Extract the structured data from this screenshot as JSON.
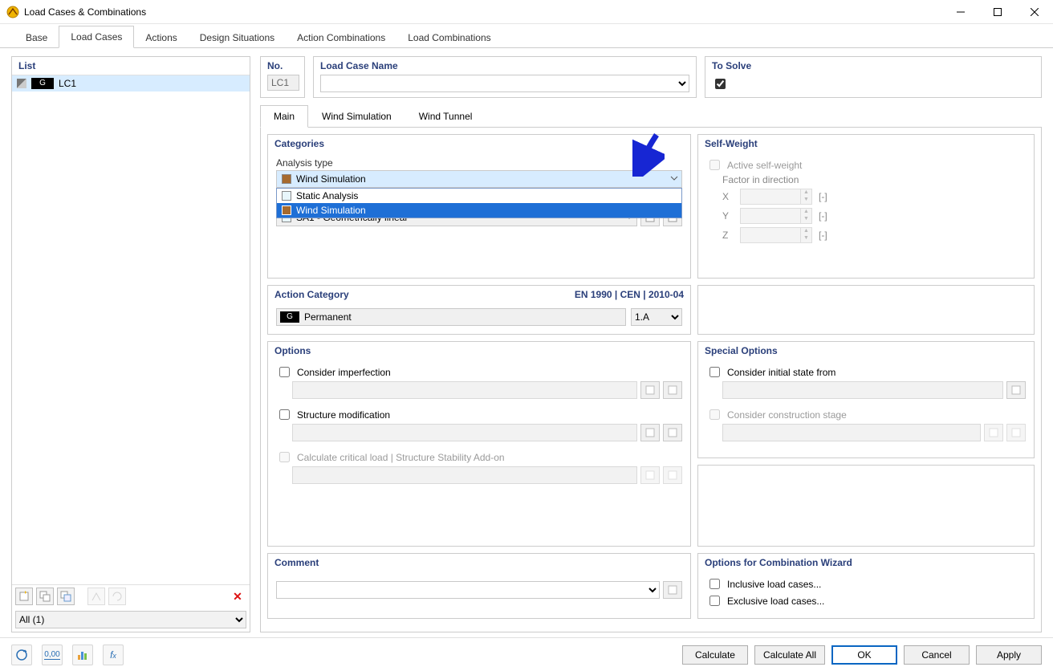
{
  "window": {
    "title": "Load Cases & Combinations"
  },
  "mainTabs": {
    "items": [
      "Base",
      "Load Cases",
      "Actions",
      "Design Situations",
      "Action Combinations",
      "Load Combinations"
    ],
    "active": 1
  },
  "list": {
    "header": "List",
    "rows": [
      {
        "badge": "G",
        "name": "LC1"
      }
    ],
    "filter": "All (1)"
  },
  "top": {
    "noLabel": "No.",
    "noValue": "LC1",
    "nameLabel": "Load Case Name",
    "nameValue": "",
    "solveLabel": "To Solve",
    "solveChecked": true
  },
  "innerTabs": {
    "items": [
      "Main",
      "Wind Simulation",
      "Wind Tunnel"
    ],
    "active": 0
  },
  "categories": {
    "header": "Categories",
    "analysisTypeLabel": "Analysis type",
    "analysisTypeValue": "Wind Simulation",
    "analysisTypeSwatch": "#a66a2e",
    "dropdownOpen": true,
    "dropdownOptions": [
      {
        "label": "Static Analysis",
        "swatch": "#e8f6fb",
        "hl": false
      },
      {
        "label": "Wind Simulation",
        "swatch": "#a66a2e",
        "hl": true
      }
    ],
    "secondCombo": "SA1 - Geometrically linear",
    "secondSwatch": "#e8f6fb"
  },
  "actionCategory": {
    "header": "Action Category",
    "standardRef": "EN 1990 | CEN | 2010-04",
    "badge": "G",
    "label": "Permanent",
    "code": "1.A"
  },
  "options": {
    "header": "Options",
    "considerImperfection": "Consider imperfection",
    "structureModification": "Structure modification",
    "criticalLoad": "Calculate critical load | Structure Stability Add-on"
  },
  "selfWeight": {
    "header": "Self-Weight",
    "active": "Active self-weight",
    "factorLabel": "Factor in direction",
    "axes": [
      "X",
      "Y",
      "Z"
    ],
    "unit": "[-]"
  },
  "specialOptions": {
    "header": "Special Options",
    "initialState": "Consider initial state from",
    "constructionStage": "Consider construction stage"
  },
  "wizard": {
    "header": "Options for Combination Wizard",
    "inclusive": "Inclusive load cases...",
    "exclusive": "Exclusive load cases..."
  },
  "comment": {
    "header": "Comment"
  },
  "footer": {
    "calculate": "Calculate",
    "calculateAll": "Calculate All",
    "ok": "OK",
    "cancel": "Cancel",
    "apply": "Apply"
  }
}
